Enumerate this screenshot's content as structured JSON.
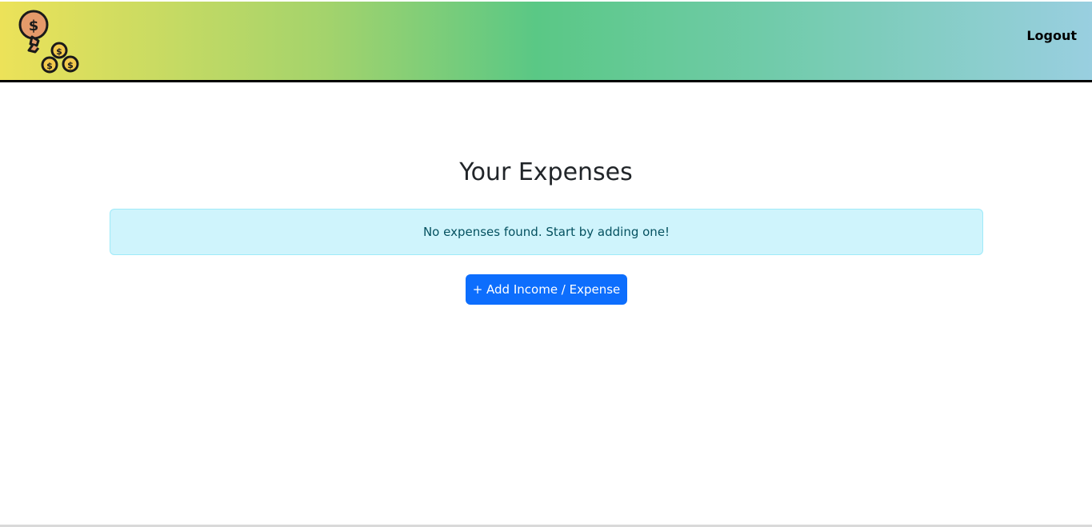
{
  "navbar": {
    "logo_icon": "money-bag-coins-icon",
    "logout_label": "Logout",
    "gradient_colors": [
      "#ece259",
      "#5ac885",
      "#99cfe0"
    ]
  },
  "main": {
    "title": "Your Expenses",
    "alert_text": "No expenses found. Start by adding one!",
    "add_button_label": "+ Add Income / Expense"
  },
  "colors": {
    "primary": "#0d6efd",
    "info_bg": "#cff4fc",
    "info_text": "#055160"
  }
}
